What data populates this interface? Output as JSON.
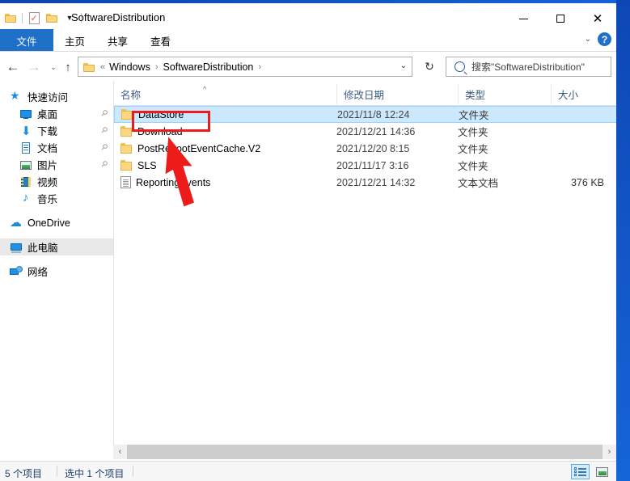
{
  "window": {
    "title": "SoftwareDistribution",
    "quick_access": [
      {
        "name": "folder-icon",
        "label": "文件资源管理器"
      },
      {
        "name": "properties-icon",
        "label": "属性"
      },
      {
        "name": "new-folder-icon",
        "label": "新建文件夹"
      },
      {
        "name": "customize-qat-chevron",
        "label": "自定义快速访问工具栏"
      }
    ],
    "controls": {
      "minimize": "—",
      "maximize": "□",
      "close": "✕"
    }
  },
  "ribbon": {
    "tabs": [
      {
        "label": "文件",
        "active": true
      },
      {
        "label": "主页",
        "active": false
      },
      {
        "label": "共享",
        "active": false
      },
      {
        "label": "查看",
        "active": false
      }
    ],
    "expand_label": "⌄",
    "help_label": "?"
  },
  "address": {
    "back": "←",
    "forward": "→",
    "history": "⌄",
    "up": "↑",
    "breadcrumb": [
      "Windows",
      "SoftwareDistribution"
    ],
    "leading_sep": "«",
    "sep": "›",
    "dropdown": "⌄",
    "refresh": "↻"
  },
  "search": {
    "placeholder": "搜索\"SoftwareDistribution\"",
    "icon": "search-icon"
  },
  "sidebar": {
    "items": [
      {
        "label": "快速访问",
        "icon": "star-icon",
        "indent": 0,
        "pinned": false,
        "selected": false
      },
      {
        "label": "桌面",
        "icon": "desktop-icon",
        "indent": 1,
        "pinned": true,
        "selected": false
      },
      {
        "label": "下载",
        "icon": "download-icon",
        "indent": 1,
        "pinned": true,
        "selected": false
      },
      {
        "label": "文档",
        "icon": "documents-icon",
        "indent": 1,
        "pinned": true,
        "selected": false
      },
      {
        "label": "图片",
        "icon": "pictures-icon",
        "indent": 1,
        "pinned": true,
        "selected": false
      },
      {
        "label": "视频",
        "icon": "videos-icon",
        "indent": 1,
        "pinned": false,
        "selected": false
      },
      {
        "label": "音乐",
        "icon": "music-icon",
        "indent": 1,
        "pinned": false,
        "selected": false
      },
      {
        "label": "OneDrive",
        "icon": "cloud-icon",
        "indent": 0,
        "pinned": false,
        "selected": false
      },
      {
        "label": "此电脑",
        "icon": "this-pc-icon",
        "indent": 0,
        "pinned": false,
        "selected": true
      },
      {
        "label": "网络",
        "icon": "network-icon",
        "indent": 0,
        "pinned": false,
        "selected": false
      }
    ],
    "pin_glyph": "📌"
  },
  "filelist": {
    "columns": [
      {
        "label": "名称",
        "sorted": "asc",
        "caret": "^"
      },
      {
        "label": "修改日期"
      },
      {
        "label": "类型"
      },
      {
        "label": "大小"
      }
    ],
    "rows": [
      {
        "name": "DataStore",
        "date": "2021/11/8 12:24",
        "type": "文件夹",
        "size": "",
        "icon": "folder-icon",
        "selected": true
      },
      {
        "name": "Download",
        "date": "2021/12/21 14:36",
        "type": "文件夹",
        "size": "",
        "icon": "folder-icon",
        "selected": false
      },
      {
        "name": "PostRebootEventCache.V2",
        "date": "2021/12/20 8:15",
        "type": "文件夹",
        "size": "",
        "icon": "folder-icon",
        "selected": false
      },
      {
        "name": "SLS",
        "date": "2021/11/17 3:16",
        "type": "文件夹",
        "size": "",
        "icon": "folder-icon",
        "selected": false
      },
      {
        "name": "ReportingEvents",
        "date": "2021/12/21 14:32",
        "type": "文本文档",
        "size": "376 KB",
        "icon": "text-file-icon",
        "selected": false
      }
    ],
    "scroll_left": "‹",
    "scroll_right": "›"
  },
  "statusbar": {
    "item_count": "5 个项目",
    "selection": "选中 1 个项目",
    "views": [
      {
        "name": "details-view-button",
        "active": true
      },
      {
        "name": "large-icons-view-button",
        "active": false
      }
    ]
  },
  "annotations": {
    "highlight_color": "#ee1b1b",
    "highlight_target": "DataStore",
    "arrow_color": "#ee1b1b"
  }
}
